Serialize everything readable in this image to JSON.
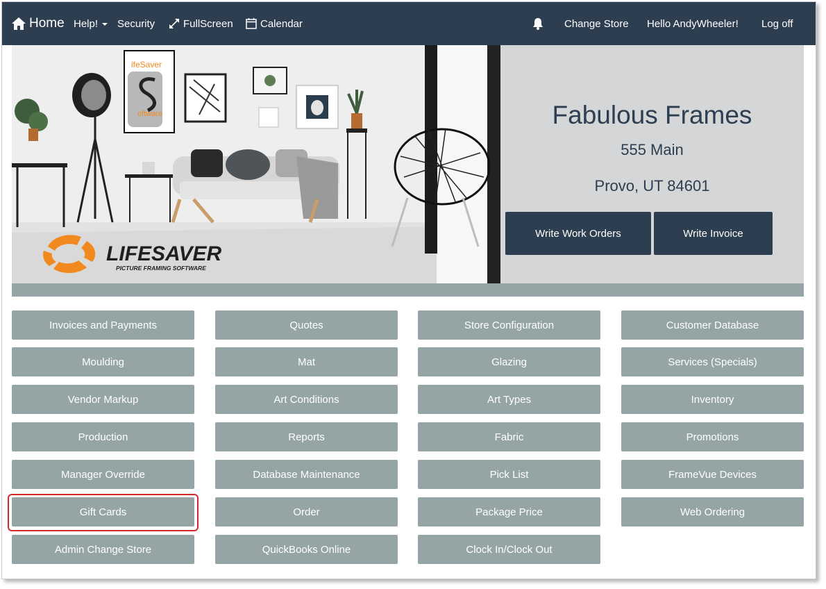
{
  "navbar": {
    "home_label": "Home",
    "help_label": "Help!",
    "security_label": "Security",
    "fullscreen_label": "FullScreen",
    "calendar_label": "Calendar",
    "change_store_label": "Change Store",
    "greeting": "Hello AndyWheeler!",
    "logoff_label": "Log off",
    "icons": [
      "home-icon",
      "caret-down-icon",
      "expand-icon",
      "calendar-icon",
      "bell-icon"
    ]
  },
  "hero": {
    "logo_lines": [
      "ifeSaver",
      "oftware"
    ],
    "brand_name": "LIFESAVER",
    "brand_tagline": "PICTURE FRAMING SOFTWARE",
    "store_name": "Fabulous Frames",
    "address_line1": "555 Main",
    "address_line2": "Provo, UT 84601",
    "write_work_orders_label": "Write Work Orders",
    "write_invoice_label": "Write Invoice"
  },
  "tiles": [
    [
      "Invoices and Payments",
      "Quotes",
      "Store Configuration",
      "Customer Database"
    ],
    [
      "Moulding",
      "Mat",
      "Glazing",
      "Services (Specials)"
    ],
    [
      "Vendor Markup",
      "Art Conditions",
      "Art Types",
      "Inventory"
    ],
    [
      "Production",
      "Reports",
      "Fabric",
      "Promotions"
    ],
    [
      "Manager Override",
      "Database Maintenance",
      "Pick List",
      "FrameVue Devices"
    ],
    [
      "Gift Cards",
      "Order",
      "Package Price",
      "Web Ordering"
    ],
    [
      "Admin Change Store",
      "QuickBooks Online",
      "Clock In/Clock Out"
    ]
  ],
  "colors": {
    "navbar": "#2d3e50",
    "tile": "#95a5a6",
    "hero_panel": "#d4d6d7",
    "accent_orange": "#f2891f",
    "highlight": "#d22a2a"
  }
}
